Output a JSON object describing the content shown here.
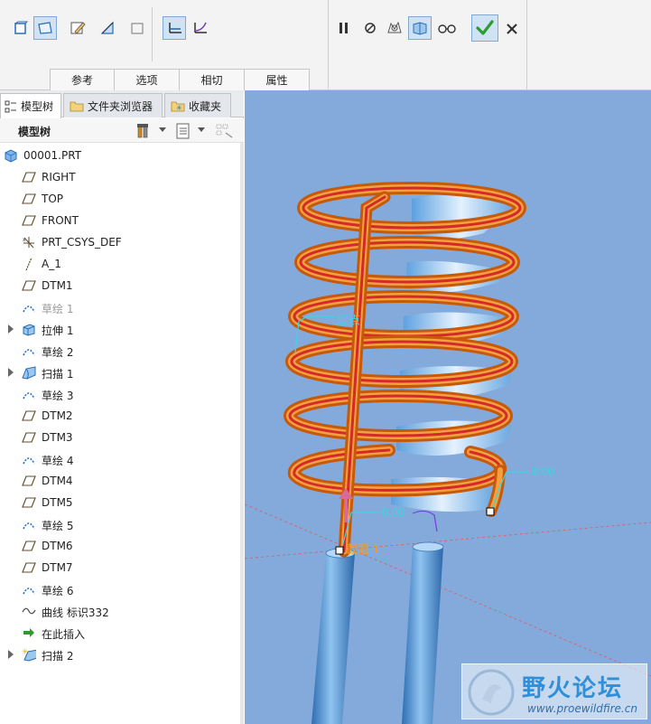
{
  "ribbon": {
    "group_tabs": [
      "参考",
      "选项",
      "相切",
      "属性"
    ],
    "tools_left": [
      "solid-icon",
      "surface-icon",
      "sketch-edit-icon",
      "remove-material-icon",
      "thin-icon",
      "constant-section-icon",
      "variable-section-icon"
    ],
    "tools_right": [
      "pause-icon",
      "no-preview-icon",
      "check-geometry-icon",
      "preview-icon",
      "glasses-icon",
      "confirm-icon",
      "cancel-icon"
    ]
  },
  "panel": {
    "tabs": [
      "模型树",
      "文件夹浏览器",
      "收藏夹"
    ],
    "toolbar_title": "模型树"
  },
  "tree": [
    {
      "label": "00001.PRT",
      "icon": "part-icon",
      "expand": false,
      "dim": false,
      "root": true
    },
    {
      "label": "RIGHT",
      "icon": "datum-plane-icon",
      "expand": false,
      "dim": false
    },
    {
      "label": "TOP",
      "icon": "datum-plane-icon",
      "expand": false,
      "dim": false
    },
    {
      "label": "FRONT",
      "icon": "datum-plane-icon",
      "expand": false,
      "dim": false
    },
    {
      "label": "PRT_CSYS_DEF",
      "icon": "csys-icon",
      "expand": false,
      "dim": false
    },
    {
      "label": "A_1",
      "icon": "datum-axis-icon",
      "expand": false,
      "dim": false
    },
    {
      "label": "DTM1",
      "icon": "datum-plane-icon",
      "expand": false,
      "dim": false
    },
    {
      "label": "草绘 1",
      "icon": "sketch-icon",
      "expand": false,
      "dim": true
    },
    {
      "label": "拉伸 1",
      "icon": "extrude-icon",
      "expand": true,
      "dim": false
    },
    {
      "label": "草绘 2",
      "icon": "sketch-icon",
      "expand": false,
      "dim": false
    },
    {
      "label": "扫描 1",
      "icon": "sweep-icon",
      "expand": true,
      "dim": false
    },
    {
      "label": "草绘 3",
      "icon": "sketch-icon",
      "expand": false,
      "dim": false
    },
    {
      "label": "DTM2",
      "icon": "datum-plane-icon",
      "expand": false,
      "dim": false
    },
    {
      "label": "DTM3",
      "icon": "datum-plane-icon",
      "expand": false,
      "dim": false
    },
    {
      "label": "草绘 4",
      "icon": "sketch-icon",
      "expand": false,
      "dim": false
    },
    {
      "label": "DTM4",
      "icon": "datum-plane-icon",
      "expand": false,
      "dim": false
    },
    {
      "label": "DTM5",
      "icon": "datum-plane-icon",
      "expand": false,
      "dim": false
    },
    {
      "label": "草绘 5",
      "icon": "sketch-icon",
      "expand": false,
      "dim": false
    },
    {
      "label": "DTM6",
      "icon": "datum-plane-icon",
      "expand": false,
      "dim": false
    },
    {
      "label": "DTM7",
      "icon": "datum-plane-icon",
      "expand": false,
      "dim": false
    },
    {
      "label": "草绘 6",
      "icon": "sketch-icon",
      "expand": false,
      "dim": false
    },
    {
      "label": "曲线 标识332",
      "icon": "curve-icon",
      "expand": false,
      "dim": false
    },
    {
      "label": "在此插入",
      "icon": "insert-here-icon",
      "expand": false,
      "dim": false
    },
    {
      "label": "扫描 2",
      "icon": "sweep-new-icon",
      "expand": true,
      "dim": false
    }
  ],
  "viewport": {
    "label_origin": "原点",
    "label_section": "截面 1",
    "dim_top": "0.00",
    "dim_bottom": "0.00",
    "colors": {
      "background": "#84aadb",
      "trajectory": "#d42a2a",
      "sweep": "#e8801e",
      "solid": "#4d96d8"
    }
  },
  "watermark": {
    "title": "野火论坛",
    "url": "www.proewildfire.cn"
  }
}
